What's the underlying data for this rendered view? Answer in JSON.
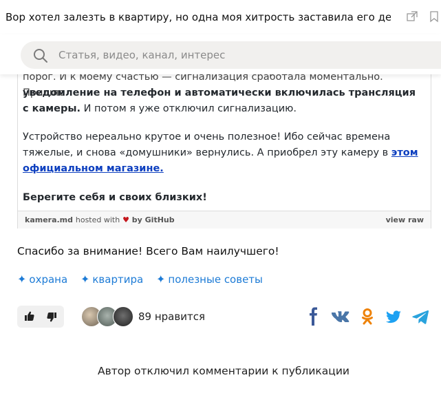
{
  "tab": {
    "title": "Вор хотел залезть в квартиру, но одна моя хитрость заставила его дел..."
  },
  "search": {
    "placeholder": "Статья, видео, канал, интерес"
  },
  "gist": {
    "cut_line": "порог. И к моему счастью — сигнализация сработала моментально. Пришло",
    "bold_line": "уведомление на телефон и автоматически включилась трансляция с камеры.",
    "after_bold": " И потом я уже отключил сигнализацию.",
    "para2": "Устройство нереально крутое и очень полезное! Ибо сейчас времена тяжелые, и снова «домушники» вернулись. А приобрел эту камеру в ",
    "link_text": "этом официальном магазине.",
    "para3": "Берегите себя и своих близких!",
    "footer_file": "kamera.md",
    "footer_hosted": "hosted with",
    "footer_by": "by GitHub",
    "footer_view_raw": "view raw"
  },
  "article": {
    "closing": "Спасибо за внимание! Всего Вам наилучшего!",
    "tags": [
      "охрана",
      "квартира",
      "полезные советы"
    ]
  },
  "reactions": {
    "like_count": "89 нравится"
  },
  "share": [
    "facebook",
    "vk",
    "odnoklassniki",
    "twitter",
    "telegram"
  ],
  "comments": {
    "disabled_text": "Автор отключил комментарии к публикации"
  },
  "colors": {
    "accent": "#1d7bd6",
    "link": "#0d3fbf",
    "facebook": "#3b5998",
    "vk": "#4a76a8",
    "ok": "#ee8208",
    "twitter": "#1da1f2",
    "telegram": "#2aa3dd"
  }
}
